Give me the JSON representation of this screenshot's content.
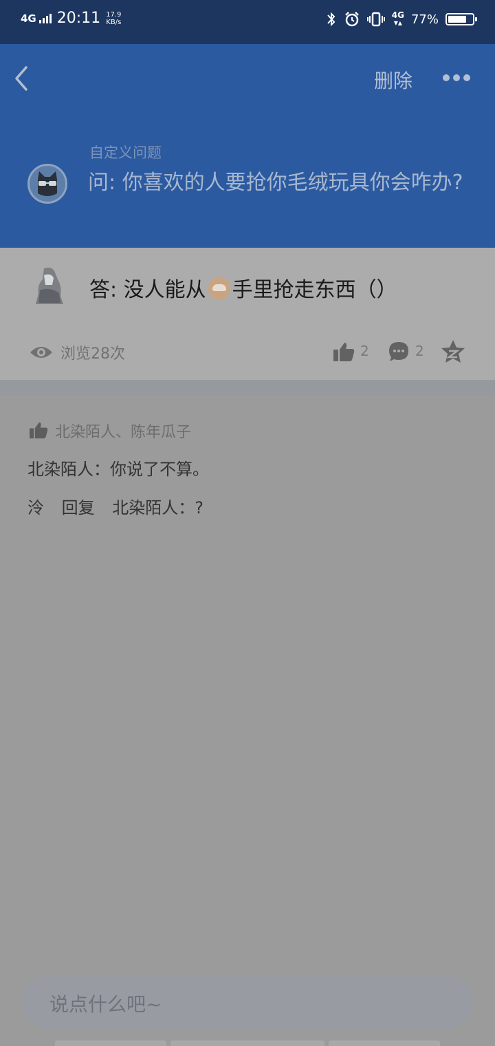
{
  "status_bar": {
    "network": "4G",
    "time": "20:11",
    "speed_value": "17.9",
    "speed_unit": "KB/s",
    "network_right": "4G",
    "battery_text": "77%",
    "battery_level": 0.77
  },
  "header": {
    "delete_label": "删除",
    "question_category": "自定义问题",
    "question_text": "问: 你喜欢的人要抢你毛绒玩具你会咋办?"
  },
  "answer": {
    "text_before": "答: 没人能从",
    "text_after": "手里抢走东西（）",
    "view_count": "浏览28次",
    "like_count": "2",
    "comment_count": "2"
  },
  "comments": {
    "likers": "北染陌人、陈年瓜子",
    "items": [
      {
        "text": "北染陌人：你说了不算。"
      },
      {
        "user": "泠",
        "reply_label": "回复",
        "text": "北染陌人：?"
      }
    ]
  },
  "input": {
    "placeholder": "说点什么吧~"
  },
  "colors": {
    "header_bg": "#2c5aa0",
    "status_bg": "#1d3660",
    "page_bg": "#9b9b9b"
  }
}
